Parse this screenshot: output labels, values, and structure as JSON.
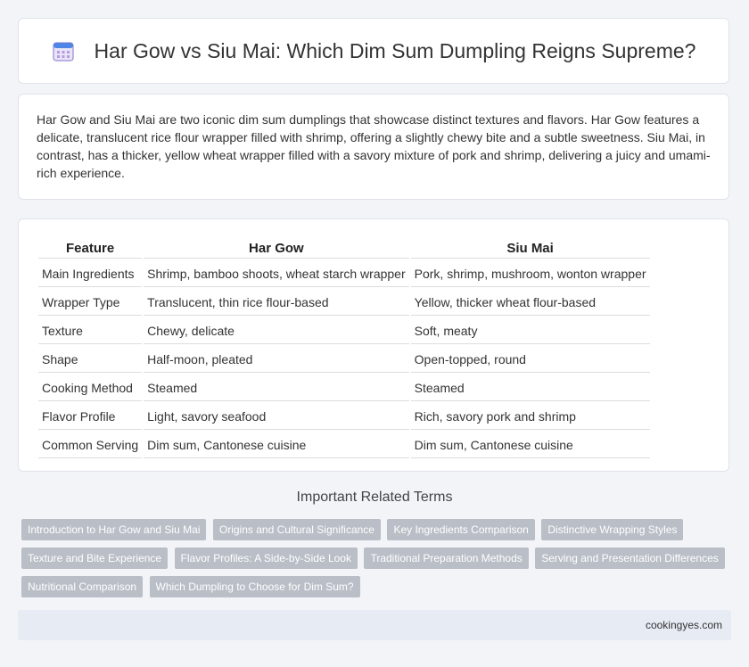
{
  "header": {
    "title": "Har Gow vs Siu Mai: Which Dim Sum Dumpling Reigns Supreme?",
    "icon": "calendar-icon"
  },
  "intro": {
    "text": "Har Gow and Siu Mai are two iconic dim sum dumplings that showcase distinct textures and flavors. Har Gow features a delicate, translucent rice flour wrapper filled with shrimp, offering a slightly chewy bite and a subtle sweetness. Siu Mai, in contrast, has a thicker, yellow wheat wrapper filled with a savory mixture of pork and shrimp, delivering a juicy and umami-rich experience."
  },
  "table": {
    "headers": [
      "Feature",
      "Har Gow",
      "Siu Mai"
    ],
    "rows": [
      [
        "Main Ingredients",
        "Shrimp, bamboo shoots, wheat starch wrapper",
        "Pork, shrimp, mushroom, wonton wrapper"
      ],
      [
        "Wrapper Type",
        "Translucent, thin rice flour-based",
        "Yellow, thicker wheat flour-based"
      ],
      [
        "Texture",
        "Chewy, delicate",
        "Soft, meaty"
      ],
      [
        "Shape",
        "Half-moon, pleated",
        "Open-topped, round"
      ],
      [
        "Cooking Method",
        "Steamed",
        "Steamed"
      ],
      [
        "Flavor Profile",
        "Light, savory seafood",
        "Rich, savory pork and shrimp"
      ],
      [
        "Common Serving",
        "Dim sum, Cantonese cuisine",
        "Dim sum, Cantonese cuisine"
      ]
    ]
  },
  "related": {
    "title": "Important Related Terms",
    "tags": [
      "Introduction to Har Gow and Siu Mai",
      "Origins and Cultural Significance",
      "Key Ingredients Comparison",
      "Distinctive Wrapping Styles",
      "Texture and Bite Experience",
      "Flavor Profiles: A Side-by-Side Look",
      "Traditional Preparation Methods",
      "Serving and Presentation Differences",
      "Nutritional Comparison",
      "Which Dumpling to Choose for Dim Sum?"
    ]
  },
  "footer": {
    "site": "cookingyes.com"
  }
}
